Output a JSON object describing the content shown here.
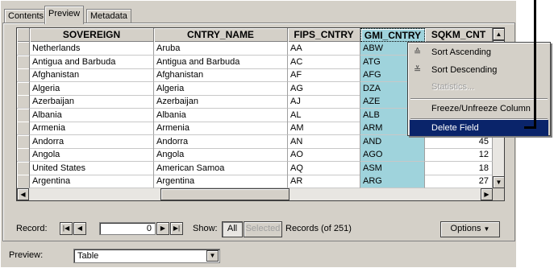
{
  "tabs": [
    "Contents",
    "Preview",
    "Metadata"
  ],
  "table": {
    "columns": [
      "SOVEREIGN",
      "CNTRY_NAME",
      "FIPS_CNTRY",
      "GMI_CNTRY",
      "SQKM_CNT"
    ],
    "rows": [
      [
        "Netherlands",
        "Aruba",
        "AA",
        "ABW",
        ""
      ],
      [
        "Antigua and Barbuda",
        "Antigua and Barbuda",
        "AC",
        "ATG",
        ""
      ],
      [
        "Afghanistan",
        "Afghanistan",
        "AF",
        "AFG",
        ""
      ],
      [
        "Algeria",
        "Algeria",
        "AG",
        "DZA",
        ""
      ],
      [
        "Azerbaijan",
        "Azerbaijan",
        "AJ",
        "AZE",
        ""
      ],
      [
        "Albania",
        "Albania",
        "AL",
        "ALB",
        ""
      ],
      [
        "Armenia",
        "Armenia",
        "AM",
        "ARM",
        ""
      ],
      [
        "Andorra",
        "Andorra",
        "AN",
        "AND",
        "45"
      ],
      [
        "Angola",
        "Angola",
        "AO",
        "AGO",
        "12"
      ],
      [
        "United States",
        "American Samoa",
        "AQ",
        "ASM",
        "18"
      ],
      [
        "Argentina",
        "Argentina",
        "AR",
        "ARG",
        "27"
      ]
    ]
  },
  "context_menu": {
    "items": [
      {
        "label": "Sort Ascending",
        "icon": "sort-ascending-icon",
        "glyph": "≙"
      },
      {
        "label": "Sort Descending",
        "icon": "sort-descending-icon",
        "glyph": "≚"
      },
      {
        "label": "Statistics...",
        "disabled": true
      },
      {
        "label": "Freeze/Unfreeze Column"
      },
      {
        "label": "Delete Field",
        "highlighted": true
      }
    ]
  },
  "navigation": {
    "record_label": "Record:",
    "record_value": "0",
    "show_label": "Show:",
    "show_all": "All",
    "show_selected": "Selected",
    "records_text": "Records (of 251)",
    "options_label": "Options"
  },
  "footer": {
    "preview_label": "Preview:",
    "preview_value": "Table"
  },
  "colors": {
    "selected_column": "#9fd3dc",
    "menu_highlight": "#0a246a",
    "chrome": "#d4d0c8"
  }
}
